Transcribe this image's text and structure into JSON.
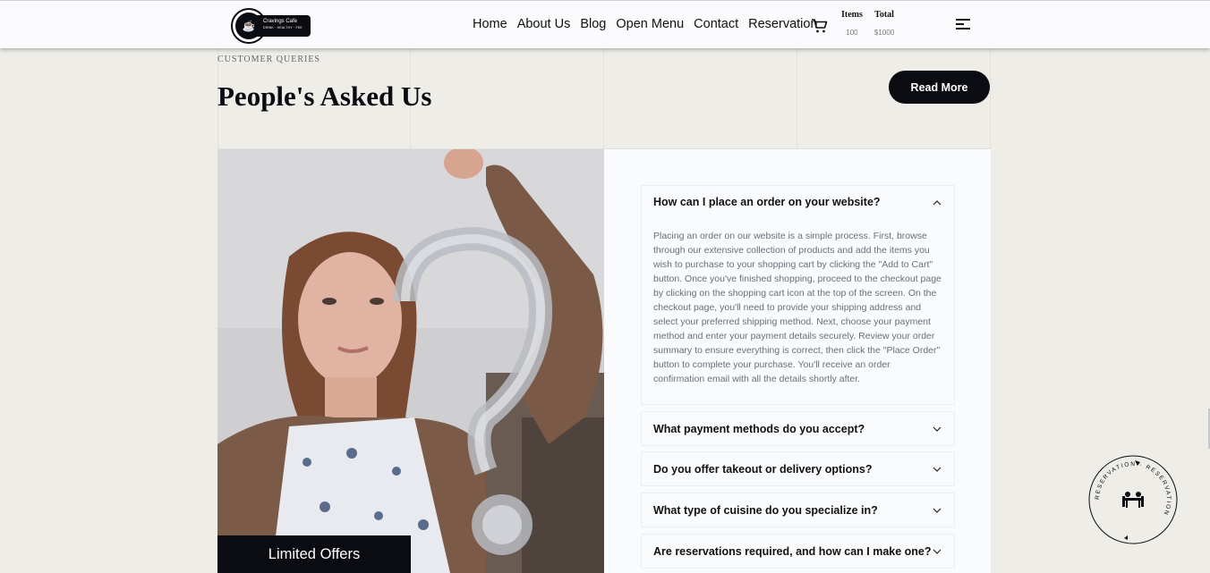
{
  "header": {
    "logo": {
      "name": "Cravings Cafe",
      "tagline": "DRINK · HEALTHY · FEE"
    },
    "nav": [
      "Home",
      "About Us",
      "Blog",
      "Open Menu",
      "Contact",
      "Reservation"
    ],
    "cart": {
      "items_label": "Items",
      "items_value": "100",
      "total_label": "Total",
      "total_value": "$1000"
    }
  },
  "section": {
    "eyebrow": "CUSTOMER QUERIES",
    "title": "People's Asked Us",
    "read_more": "Read More"
  },
  "photo": {
    "overlay_label": "Limited Offers"
  },
  "faq": {
    "open": {
      "question": "How can I place an order on your website?",
      "answer": "Placing an order on our website is a simple process. First, browse through our extensive collection of products and add the items you wish to purchase to your shopping cart by clicking the \"Add to Cart\" button. Once you've finished shopping, proceed to the checkout page by clicking on the shopping cart icon at the top of the screen. On the checkout page, you'll need to provide your shipping address and select your preferred shipping method. Next, choose your payment method and enter your payment details securely. Review your order summary to ensure everything is correct, then click the \"Place Order\" button to complete your purchase. You'll receive an order confirmation email with all the details shortly after."
    },
    "collapsed": [
      "What payment methods do you accept?",
      "Do you offer takeout or delivery options?",
      "What type of cuisine do you specialize in?",
      "Are reservations required, and how can I make one?"
    ]
  },
  "badge": {
    "text": "RESERVATION · RESERVATION"
  },
  "colors": {
    "dark": "#0b0b12",
    "page_bg": "#eeede8",
    "panel_bg": "#fafbfd"
  }
}
